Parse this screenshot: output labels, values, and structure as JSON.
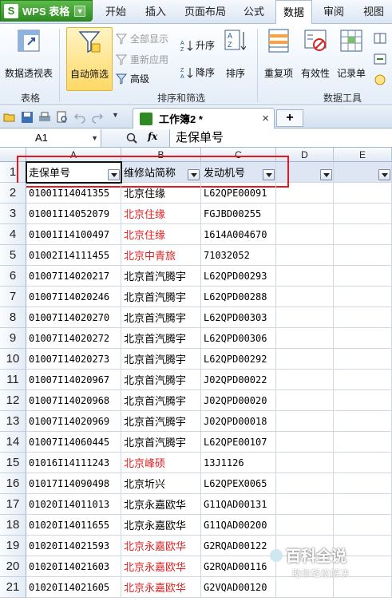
{
  "app": {
    "title": "WPS 表格"
  },
  "menu": {
    "tabs": [
      {
        "label": "开始"
      },
      {
        "label": "插入"
      },
      {
        "label": "页面布局"
      },
      {
        "label": "公式"
      },
      {
        "label": "数据",
        "active": true
      },
      {
        "label": "审阅"
      },
      {
        "label": "视图"
      }
    ]
  },
  "ribbon": {
    "pivot_table": "数据透视表",
    "auto_filter": "自动筛选",
    "show_all": "全部显示",
    "reapply": "重新应用",
    "advanced": "高级",
    "sort_asc": "升序",
    "sort_desc": "降序",
    "sort": "排序",
    "duplicates": "重复项",
    "validity": "有效性",
    "record_sheet": "记录单",
    "groups": {
      "table": "表格",
      "sort_filter": "排序和筛选",
      "data_tools": "数据工具"
    }
  },
  "document": {
    "tab_name": "工作簿2 *",
    "close_symbol": "×",
    "new_tab_symbol": "+"
  },
  "formula_bar": {
    "cell_ref": "A1",
    "fx_label": "fx",
    "content": "走保单号"
  },
  "sheet": {
    "columns": [
      "A",
      "B",
      "C",
      "D",
      "E"
    ],
    "header_row": {
      "row_number": "1",
      "cells": [
        "走保单号",
        "维修站简称",
        "发动机号"
      ]
    },
    "rows": [
      {
        "n": "2",
        "a": "01001I14041355",
        "b": "北京住缘",
        "c": "L62QPE00091",
        "red": false
      },
      {
        "n": "3",
        "a": "01001I14052079",
        "b": "北京住缘",
        "c": "FGJBD00255",
        "red": true
      },
      {
        "n": "4",
        "a": "01001I14100497",
        "b": "北京住缘",
        "c": "1614A004670",
        "red": true
      },
      {
        "n": "5",
        "a": "01002I14111455",
        "b": "北京中青旅",
        "c": "71032052",
        "red": true
      },
      {
        "n": "6",
        "a": "01007I14020217",
        "b": "北京首汽腾宇",
        "c": "L62QPD00293",
        "red": false
      },
      {
        "n": "7",
        "a": "01007I14020246",
        "b": "北京首汽腾宇",
        "c": "L62QPD00288",
        "red": false
      },
      {
        "n": "8",
        "a": "01007I14020270",
        "b": "北京首汽腾宇",
        "c": "L62QPD00303",
        "red": false
      },
      {
        "n": "9",
        "a": "01007I14020272",
        "b": "北京首汽腾宇",
        "c": "L62QPD00306",
        "red": false
      },
      {
        "n": "10",
        "a": "01007I14020273",
        "b": "北京首汽腾宇",
        "c": "L62QPD00292",
        "red": false
      },
      {
        "n": "11",
        "a": "01007I14020967",
        "b": "北京首汽腾宇",
        "c": "J02QPD00022",
        "red": false
      },
      {
        "n": "12",
        "a": "01007I14020968",
        "b": "北京首汽腾宇",
        "c": "J02QPD00020",
        "red": false
      },
      {
        "n": "13",
        "a": "01007I14020969",
        "b": "北京首汽腾宇",
        "c": "J02QPD00018",
        "red": false
      },
      {
        "n": "14",
        "a": "01007I14060445",
        "b": "北京首汽腾宇",
        "c": "L62QPE00107",
        "red": false
      },
      {
        "n": "15",
        "a": "01016I14111243",
        "b": "北京峰硕",
        "c": "13J1126",
        "red": true
      },
      {
        "n": "16",
        "a": "01017I14090498",
        "b": "北京圻兴",
        "c": "L62QPEX0065",
        "red": false
      },
      {
        "n": "17",
        "a": "01020I14011013",
        "b": "北京永嘉欧华",
        "c": "G11QAD00131",
        "red": false
      },
      {
        "n": "18",
        "a": "01020I14011655",
        "b": "北京永嘉欧华",
        "c": "G11QAD00200",
        "red": false
      },
      {
        "n": "19",
        "a": "01020I14021593",
        "b": "北京永嘉欧华",
        "c": "G2RQAD00122",
        "red": true
      },
      {
        "n": "20",
        "a": "01020I14021603",
        "b": "北京永嘉欧华",
        "c": "G2RQAD00116",
        "red": true
      },
      {
        "n": "21",
        "a": "01020I14021605",
        "b": "北京永嘉欧华",
        "c": "G2VQAD00120",
        "red": true
      }
    ]
  },
  "watermark": {
    "main": "百科全说",
    "sub": "助你轻松解决"
  },
  "colors": {
    "accent_red": "#e4181e",
    "red_text": "#e02222",
    "wps_green": "#2e8b22"
  }
}
